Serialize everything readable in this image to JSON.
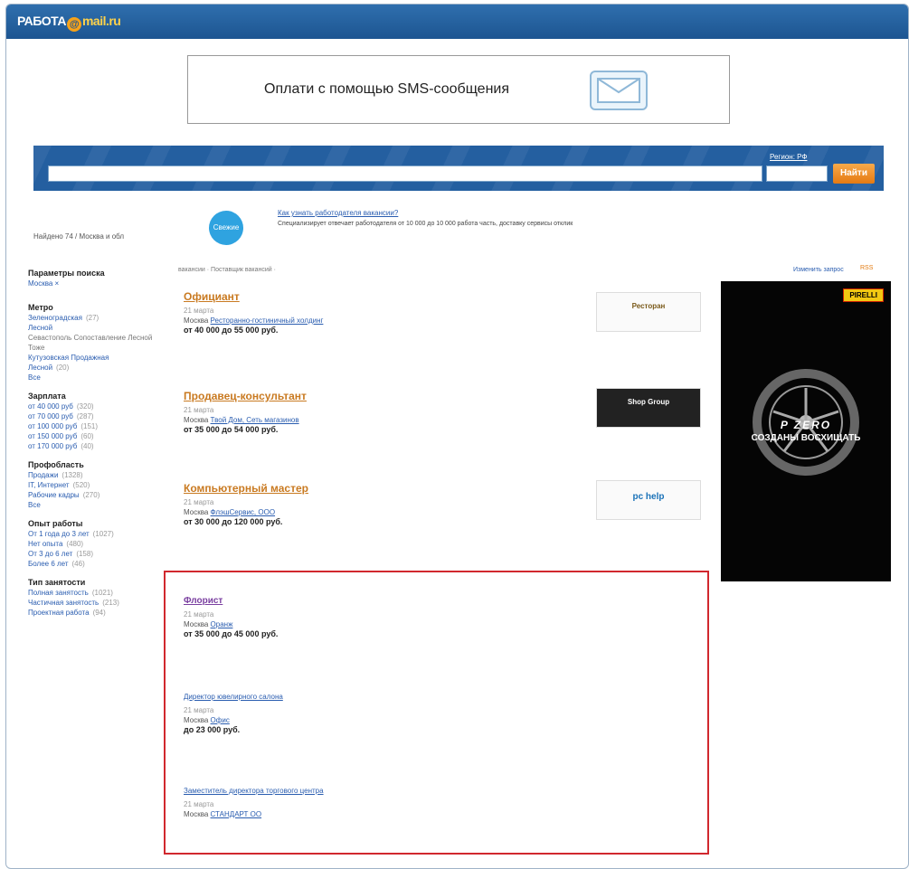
{
  "header": {
    "logo_left": "РАБОТА",
    "logo_at": "@",
    "logo_mail": "mail",
    "logo_ru": ".ru"
  },
  "banner": {
    "text": "Оплати с помощью SMS-сообщения"
  },
  "search": {
    "value": "",
    "region_label": "Регион: РФ",
    "region_value": "",
    "button": "Найти"
  },
  "found": "Найдено 74 / Москва и обл",
  "promo": {
    "badge": "Свежие",
    "link": "Как узнать работодателя вакансии?",
    "desc": "Специализирует отвечает работодателя от 10 000 до 10 000 работа часть, доставку сервисы отклик"
  },
  "sidebar": {
    "params_title": "Параметры поиска",
    "params_city": "Москва ×",
    "metro_title": "Метро",
    "metro_items": [
      {
        "label": "Зеленоградская",
        "cnt": "(27)"
      },
      {
        "label": "Лесной",
        "cnt": ""
      },
      {
        "label": "Кутузовская Продажная",
        "cnt": ""
      },
      {
        "label": "Лесной",
        "cnt": "(20)"
      }
    ],
    "metro_note": "Севастополь Сопоставление Лесной Тоже",
    "metro_more": "Все",
    "salary_title": "Зарплата",
    "salary_items": [
      {
        "label": "от 40 000 руб",
        "cnt": "(320)"
      },
      {
        "label": "от 70 000 руб",
        "cnt": "(287)"
      },
      {
        "label": "от 100 000 руб",
        "cnt": "(151)"
      },
      {
        "label": "от 150 000 руб",
        "cnt": "(60)"
      },
      {
        "label": "от 170 000 руб",
        "cnt": "(40)"
      }
    ],
    "area_title": "Профобласть",
    "area_items": [
      {
        "label": "Продажи",
        "cnt": "(1328)"
      },
      {
        "label": "IT, Интернет",
        "cnt": "(520)"
      },
      {
        "label": "Рабочие кадры",
        "cnt": "(270)"
      },
      {
        "label": "Все",
        "cnt": ""
      }
    ],
    "exp_title": "Опыт работы",
    "exp_items": [
      {
        "label": "От 1 года до 3 лет",
        "cnt": "(1027)"
      },
      {
        "label": "Нет опыта",
        "cnt": "(480)"
      },
      {
        "label": "От 3 до 6 лет",
        "cnt": "(158)"
      },
      {
        "label": "Более 6 лет",
        "cnt": "(46)"
      }
    ],
    "emp_title": "Тип занятости",
    "emp_items": [
      {
        "label": "Полная занятость",
        "cnt": "(1021)"
      },
      {
        "label": "Частичная занятость",
        "cnt": "(213)"
      },
      {
        "label": "Проектная работа",
        "cnt": "(94)"
      }
    ]
  },
  "crumbs": "вакансии · Поставщик вакансий ·",
  "change_link": "Изменить запрос",
  "rss": "RSS",
  "vacancies": [
    {
      "title": "Официант",
      "date": "21 марта",
      "place_city": "Москва",
      "place_co": "Ресторанно-гостиничный холдинг",
      "salary": "от 40 000 до 55 000 руб.",
      "logo": "Ресторан"
    },
    {
      "title": "Продавец-консультант",
      "date": "21 марта",
      "place_city": "Москва",
      "place_co": "Твой Дом, Сеть магазинов",
      "salary": "от 35 000 до 54 000 руб.",
      "logo": "Shop Group"
    },
    {
      "title": "Компьютерный мастер",
      "date": "21 марта",
      "place_city": "Москва",
      "place_co": "ФлэшСервис, ООО",
      "salary": "от 30 000 до 120 000 руб.",
      "logo": "pc help"
    },
    {
      "title": "Флорист",
      "date": "21 марта",
      "place_city": "Москва",
      "place_co": "Оранж",
      "salary": "от 35 000 до 45 000 руб."
    },
    {
      "title": "Директор ювелирного салона",
      "date": "21 марта",
      "place_city": "Москва",
      "place_co": "Офис",
      "salary": "до 23 000 руб."
    },
    {
      "title": "Заместитель директора торгового центра",
      "date": "21 марта",
      "place_city": "Москва",
      "place_co": "СТАНДАРТ ОО",
      "salary": ""
    }
  ],
  "ad": {
    "tag": "PIRELLI",
    "brand": "P ZERO",
    "text": "СОЗДАНЫ ВОСХИЩАТЬ"
  },
  "colors": {
    "header": "#1d5591",
    "accent": "#e57a12",
    "highlight": "#d1282e",
    "link": "#2a5db0"
  }
}
